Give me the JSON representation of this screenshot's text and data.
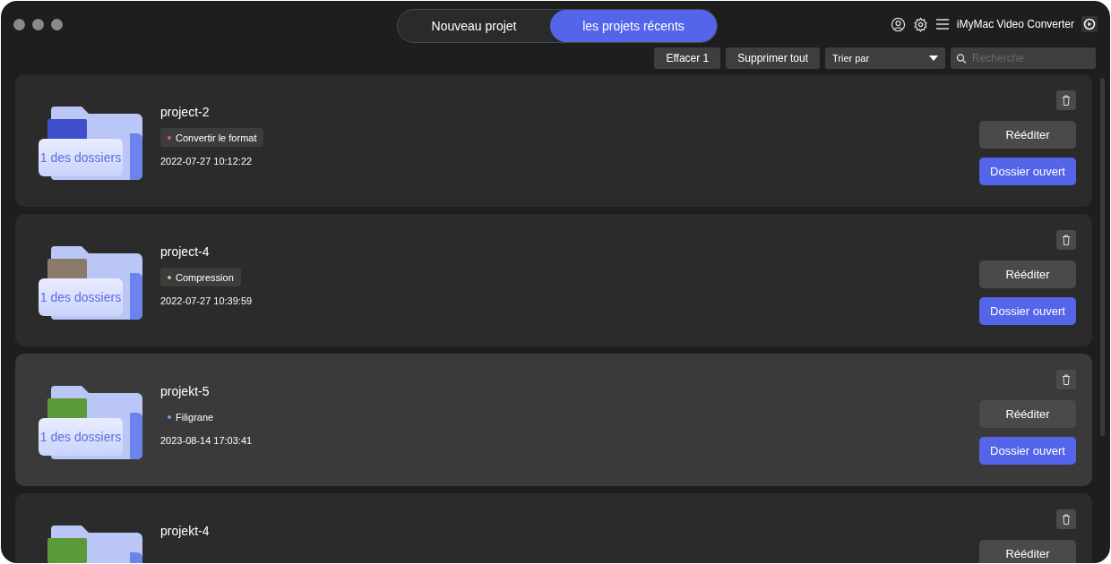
{
  "window": {
    "title": "iMyMac Video Converter"
  },
  "tabs": [
    {
      "label": "Nouveau projet",
      "selected": false
    },
    {
      "label": "les projets récents",
      "selected": true
    }
  ],
  "toolbar": {
    "clear_button": "Effacer 1",
    "delete_all_button": "Supprimer tout",
    "sort": {
      "value": "Trier par"
    },
    "search": {
      "placeholder": "Recherche"
    }
  },
  "projects": [
    {
      "name": "project-2",
      "folder_label": "1 des dossiers",
      "tag": {
        "label": "Convertir le format",
        "color": "#e0566a"
      },
      "date": "2022-07-27 10:12:22",
      "selected": false,
      "buttons": [
        "Rééditer",
        "Dossier ouvert"
      ]
    },
    {
      "name": "project-4",
      "folder_label": "1 des dossiers",
      "tag": {
        "label": "Compression",
        "color": "#9be07a"
      },
      "date": "2022-07-27 10:39:59",
      "selected": false,
      "buttons": [
        "Rééditer",
        "Dossier ouvert"
      ]
    },
    {
      "name": "projekt-5",
      "folder_label": "1 des dossiers",
      "tag": {
        "label": "Filigrane",
        "color": "#6d9fe8"
      },
      "date": "2023-08-14 17:03:41",
      "selected": true,
      "buttons": [
        "Rééditer",
        "Dossier ouvert"
      ]
    },
    {
      "name": "projekt-4",
      "selected": false,
      "buttons": [
        "Rééditer"
      ]
    }
  ]
}
